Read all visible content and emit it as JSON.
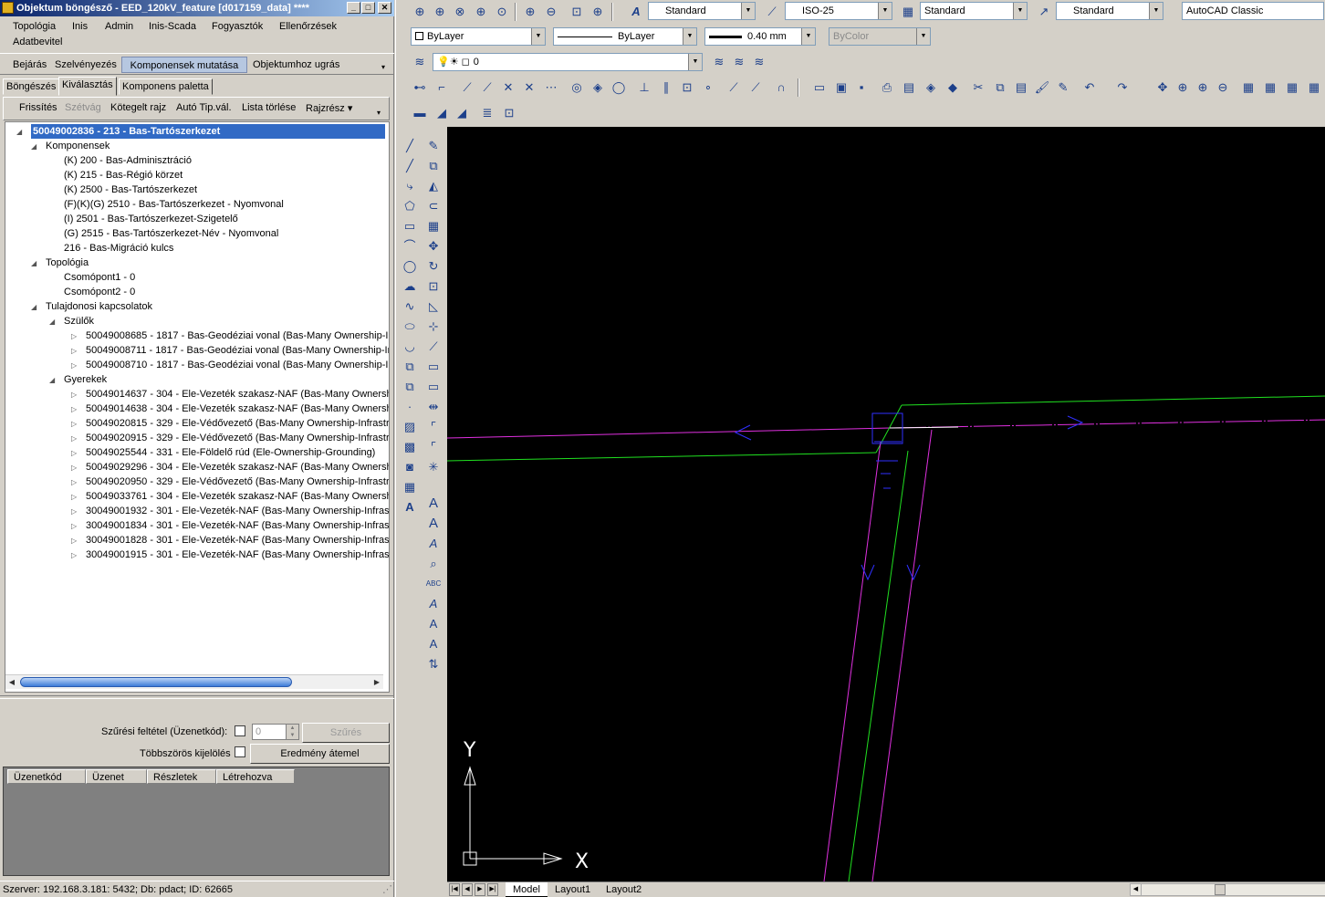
{
  "window": {
    "title": "Objektum böngésző - EED_120kV_feature [d017159_data] ****",
    "min_glyph": "_",
    "max_glyph": "□",
    "close_glyph": "✕"
  },
  "menu": [
    "Topológia",
    "Inis",
    "Admin",
    "Inis-Scada",
    "Fogyasztók",
    "Ellenőrzések",
    "Adatbevitel"
  ],
  "toolbar1": [
    "Bejárás",
    "Szelvényezés",
    "Komponensek mutatása",
    "Objektumhoz ugrás"
  ],
  "tabs": [
    "Böngészés",
    "Kiválasztás",
    "Komponens paletta"
  ],
  "toolbar2": {
    "items": [
      "Frissítés",
      "Szétvág",
      "Kötegelt rajz",
      "Autó Tip.vál.",
      "Lista törlése",
      "Rajzrész ▾"
    ],
    "disabled": [
      "Szétvág"
    ]
  },
  "tree": {
    "root": "50049002836 - 213 - Bas-Tartószerkezet",
    "components_label": "Komponensek",
    "components": [
      "(K) 200 - Bas-Adminisztráció",
      "(K) 215 - Bas-Régió körzet",
      "(K) 2500 - Bas-Tartószerkezet",
      "(F)(K)(G) 2510 - Bas-Tartószerkezet - Nyomvonal",
      "(I) 2501 - Bas-Tartószerkezet-Szigetelő",
      "(G) 2515 - Bas-Tartószerkezet-Név - Nyomvonal",
      "216 - Bas-Migráció kulcs"
    ],
    "topology_label": "Topológia",
    "topology": [
      "Csomópont1 - 0",
      "Csomópont2 - 0"
    ],
    "ownership_label": "Tulajdonosi kapcsolatok",
    "parents_label": "Szülők",
    "parents": [
      "50049008685 - 1817 - Bas-Geodéziai vonal (Bas-Many Ownership-In",
      "50049008711 - 1817 - Bas-Geodéziai vonal (Bas-Many Ownership-In",
      "50049008710 - 1817 - Bas-Geodéziai vonal (Bas-Many Ownership-In"
    ],
    "children_label": "Gyerekek",
    "children": [
      "50049014637 - 304 - Ele-Vezeték szakasz-NAF (Bas-Many Ownersh",
      "50049014638 - 304 - Ele-Vezeték szakasz-NAF (Bas-Many Ownersh",
      "50049020815 - 329 - Ele-Védővezető (Bas-Many Ownership-Infrastr",
      "50049020915 - 329 - Ele-Védővezető (Bas-Many Ownership-Infrastr",
      "50049025544 - 331 - Ele-Földelő rúd (Ele-Ownership-Grounding)",
      "50049029296 - 304 - Ele-Vezeték szakasz-NAF (Bas-Many Ownersh",
      "50049020950 - 329 - Ele-Védővezető (Bas-Many Ownership-Infrastr",
      "50049033761 - 304 - Ele-Vezeték szakasz-NAF (Bas-Many Ownersh",
      "30049001932 - 301 - Ele-Vezeték-NAF (Bas-Many Ownership-Infras",
      "30049001834 - 301 - Ele-Vezeték-NAF (Bas-Many Ownership-Infras",
      "30049001828 - 301 - Ele-Vezeték-NAF (Bas-Many Ownership-Infras",
      "30049001915 - 301 - Ele-Vezeték-NAF (Bas-Many Ownership-Infras"
    ]
  },
  "filter": {
    "label": "Szűrési feltétel (Üzenetkód):",
    "value": "0",
    "button": "Szűrés",
    "multi_label": "Többszörös kijelölés",
    "result_button": "Eredmény átemel"
  },
  "grid_headers": [
    "Üzenetkód",
    "Üzenet",
    "Részletek",
    "Létrehozva"
  ],
  "status": "Szerver: 192.168.3.181: 5432; Db: pdact; ID: 62665",
  "cad": {
    "text_style": "Standard",
    "dim_style": "ISO-25",
    "table_style": "Standard",
    "multileader_style": "Standard",
    "workspace": "AutoCAD Classic",
    "layer_color": "ByLayer",
    "linetype": "ByLayer",
    "lineweight": "0.40 mm",
    "plotstyle": "ByColor",
    "layer": "0",
    "layout_tabs": [
      "Model",
      "Layout1",
      "Layout2"
    ],
    "ucs_x": "X",
    "ucs_y": "Y",
    "colors": {
      "magenta": "#e030e0",
      "green": "#20e020",
      "blue": "#3030ff",
      "canvas": "#000000"
    }
  }
}
